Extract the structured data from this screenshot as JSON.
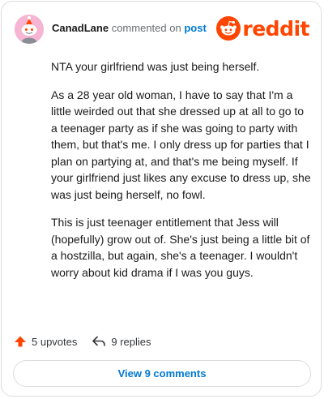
{
  "comment": {
    "username": "CanadLane",
    "action_text": "commented on",
    "post_link": "post",
    "paragraphs": [
      "NTA your girlfriend was just being herself.",
      "As a 28 year old woman, I have to say that I'm a little weirded out that she dressed up at all to go to a teenager party as if she was going to party with them, but that's me. I only dress up for parties that I plan on partying at, and that's me being myself. If your girlfriend just likes any excuse to dress up, she was just being herself, no fowl.",
      "This is just teenager entitlement that Jess will (hopefully) grow out of. She's just being a little bit of a hostzilla, but again, she's a teenager. I wouldn't worry about kid drama if I was you guys."
    ]
  },
  "brand": {
    "wordmark": "reddit",
    "icon": "reddit-snoo-icon",
    "color": "#ff4500"
  },
  "footer": {
    "upvotes": "5 upvotes",
    "replies": "9 replies",
    "upvote_icon": "upvote-arrow-icon",
    "reply_icon": "reply-arrow-icon"
  },
  "view_comments_label": "View 9 comments",
  "colors": {
    "link_blue": "#0079d3",
    "upvote_orange": "#ff4500",
    "avatar_pink": "#f5b5d3"
  }
}
